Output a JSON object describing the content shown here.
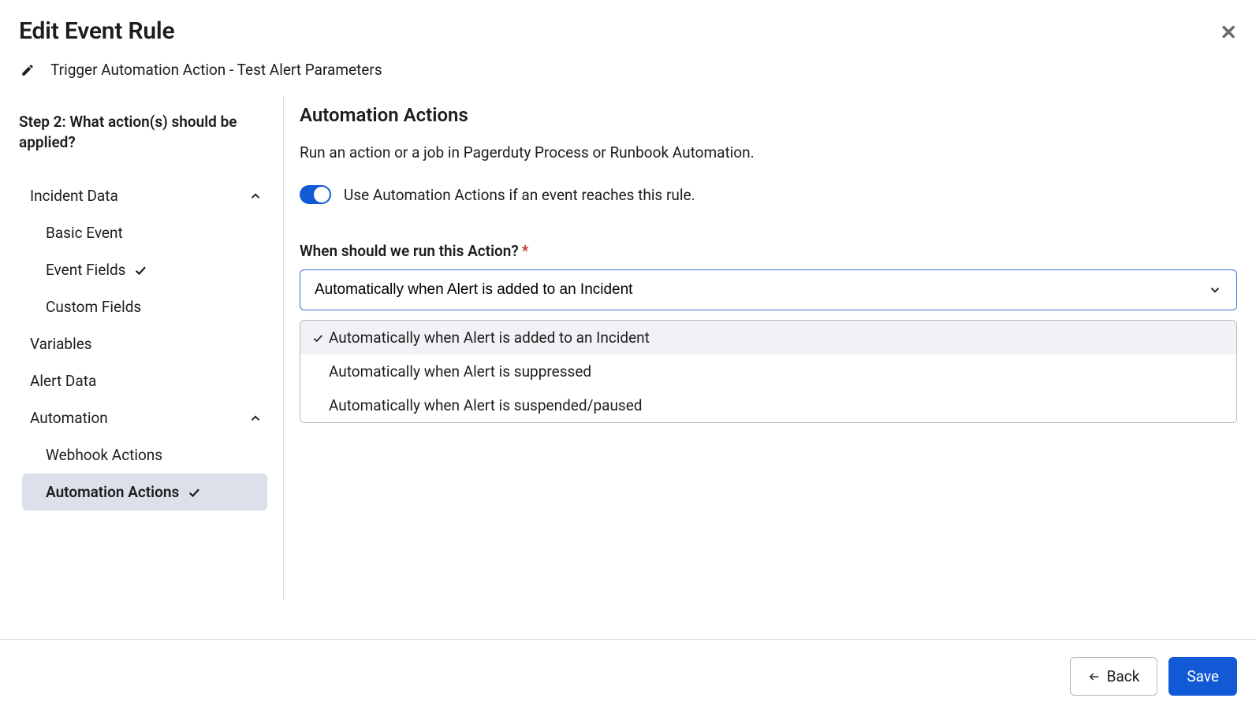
{
  "header": {
    "title": "Edit Event Rule",
    "subtitle": "Trigger Automation Action - Test Alert Parameters"
  },
  "sidebar": {
    "step_label": "Step 2: What action(s) should be applied?",
    "groups": [
      {
        "label": "Incident Data",
        "expanded": true,
        "items": [
          {
            "label": "Basic Event",
            "checked": false
          },
          {
            "label": "Event Fields",
            "checked": true
          },
          {
            "label": "Custom Fields",
            "checked": false
          }
        ]
      }
    ],
    "items": [
      {
        "label": "Variables"
      },
      {
        "label": "Alert Data"
      }
    ],
    "automation_group": {
      "label": "Automation",
      "expanded": true,
      "items": [
        {
          "label": "Webhook Actions",
          "checked": false,
          "active": false
        },
        {
          "label": "Automation Actions",
          "checked": true,
          "active": true
        }
      ]
    }
  },
  "main": {
    "section_title": "Automation Actions",
    "section_desc": "Run an action or a job in Pagerduty Process or Runbook Automation.",
    "toggle_label": "Use Automation Actions if an event reaches this rule.",
    "field_label": "When should we run this Action?",
    "select_value": "Automatically when Alert is added to an Incident",
    "options": [
      {
        "label": "Automatically when Alert is added to an Incident",
        "selected": true
      },
      {
        "label": "Automatically when Alert is suppressed",
        "selected": false
      },
      {
        "label": "Automatically when Alert is suspended/paused",
        "selected": false
      }
    ]
  },
  "footer": {
    "back_label": "Back",
    "save_label": "Save"
  }
}
